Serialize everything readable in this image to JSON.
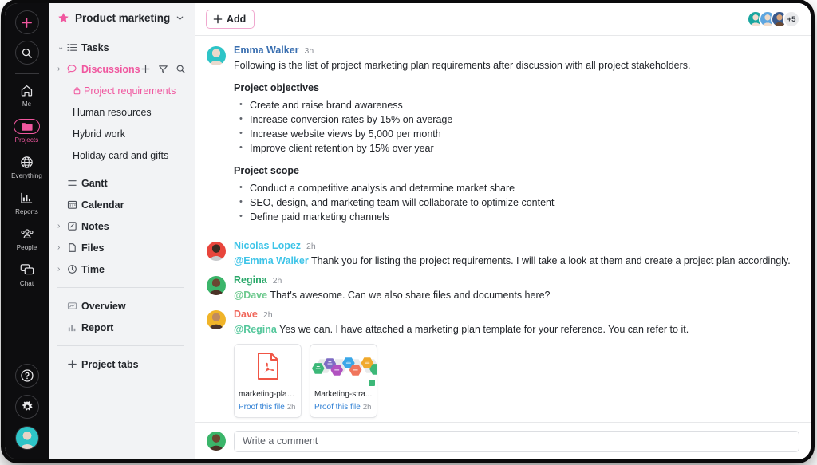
{
  "colors": {
    "accent": "#f0579f",
    "rail_bg": "#0d0d0f",
    "sidebar_bg": "#f2f3f5",
    "link": "#2e7fd4"
  },
  "nav_rail": {
    "add_icon": "plus-icon",
    "search_icon": "search-icon",
    "items": [
      {
        "label": "Me",
        "icon": "home-icon",
        "active": false
      },
      {
        "label": "Projects",
        "icon": "folder-icon",
        "active": true
      },
      {
        "label": "Everything",
        "icon": "globe-icon",
        "active": false
      },
      {
        "label": "Reports",
        "icon": "bar-chart-icon",
        "active": false
      },
      {
        "label": "People",
        "icon": "people-icon",
        "active": false
      },
      {
        "label": "Chat",
        "icon": "chat-bubbles-icon",
        "active": false
      }
    ],
    "bottom": [
      {
        "name": "help-icon",
        "glyph": "?"
      },
      {
        "name": "settings-icon",
        "glyph": "gear"
      },
      {
        "name": "user-avatar",
        "glyph": "avatar"
      }
    ]
  },
  "sidebar": {
    "project_title": "Product marketing",
    "project_star_icon": "star-icon",
    "project_chevron_icon": "chevron-down-icon",
    "rows": [
      {
        "label": "Tasks",
        "icon": "tasks-icon",
        "caret": "v",
        "accent": false
      },
      {
        "label": "Discussions",
        "icon": "discussion-icon",
        "caret": ">",
        "accent": true,
        "actions": [
          "plus-icon",
          "filter-icon",
          "search-icon"
        ]
      }
    ],
    "discussion_items": [
      {
        "label": "Project requirements",
        "selected": true,
        "lock_icon": "lock-icon"
      },
      {
        "label": "Human resources",
        "selected": false
      },
      {
        "label": "Hybrid work",
        "selected": false
      },
      {
        "label": "Holiday card and gifts",
        "selected": false
      }
    ],
    "rows2": [
      {
        "label": "Gantt",
        "icon": "gantt-icon",
        "caret": ""
      },
      {
        "label": "Calendar",
        "icon": "calendar-icon",
        "caret": ""
      },
      {
        "label": "Notes",
        "icon": "notes-icon",
        "caret": ">"
      },
      {
        "label": "Files",
        "icon": "file-icon",
        "caret": ">"
      },
      {
        "label": "Time",
        "icon": "clock-icon",
        "caret": ">"
      }
    ],
    "rows3": [
      {
        "label": "Overview",
        "icon": "overview-icon"
      },
      {
        "label": "Report",
        "icon": "report-icon"
      }
    ],
    "add_tabs": {
      "label": "Project tabs",
      "icon": "plus-icon"
    }
  },
  "toolbar": {
    "add_label": "Add",
    "add_icon": "plus-icon",
    "more_members_count": "+5",
    "avatar_count": 3
  },
  "thread": {
    "posts": [
      {
        "name": "Emma Walker",
        "name_color": "#3a6fb0",
        "time": "3h",
        "avatar_color": "#2ec4c7",
        "text": "Following is the list of project marketing plan requirements after discussion with all project stakeholders.",
        "sections": [
          {
            "title": "Project objectives",
            "bullets": [
              "Create and raise brand awareness",
              "Increase conversion rates by 15% on average",
              "Increase website views by 5,000 per month",
              "Improve client retention by 15% over year"
            ]
          },
          {
            "title": "Project scope",
            "bullets": [
              "Conduct a competitive analysis and determine market share",
              "SEO, design, and marketing team will collaborate to optimize content",
              "Define paid marketing channels"
            ]
          }
        ]
      },
      {
        "name": "Nicolas Lopez",
        "name_color": "#3ec4e8",
        "time": "2h",
        "avatar_color": "#e8453c",
        "mention": "@Emma Walker",
        "mention_color": "#3ec4e8",
        "text": "Thank you for listing the project requirements. I will take a look at them and create a project plan accordingly."
      },
      {
        "name": "Regina",
        "name_color": "#2aa86a",
        "time": "2h",
        "avatar_color": "#3bb56a",
        "mention": "@Dave",
        "mention_color": "#6dc98e",
        "text": "That's awesome. Can we also share files and documents here?"
      },
      {
        "name": "Dave",
        "name_color": "#f0685c",
        "time": "2h",
        "avatar_color": "#f0b429",
        "mention": "@Regina",
        "mention_color": "#54c79b",
        "text": "Yes we can. I have attached a marketing plan template for your reference. You can refer to it."
      }
    ],
    "attachments": [
      {
        "name": "marketing-plan...",
        "thumb": "pdf-icon",
        "proof_label": "Proof this file",
        "age": "2h"
      },
      {
        "name": "Marketing-stra...",
        "thumb": "image-thumbnail",
        "proof_label": "Proof this file",
        "age": "2h"
      }
    ]
  },
  "composer": {
    "placeholder": "Write a comment",
    "value": "",
    "avatar_color": "#3bb56a"
  }
}
